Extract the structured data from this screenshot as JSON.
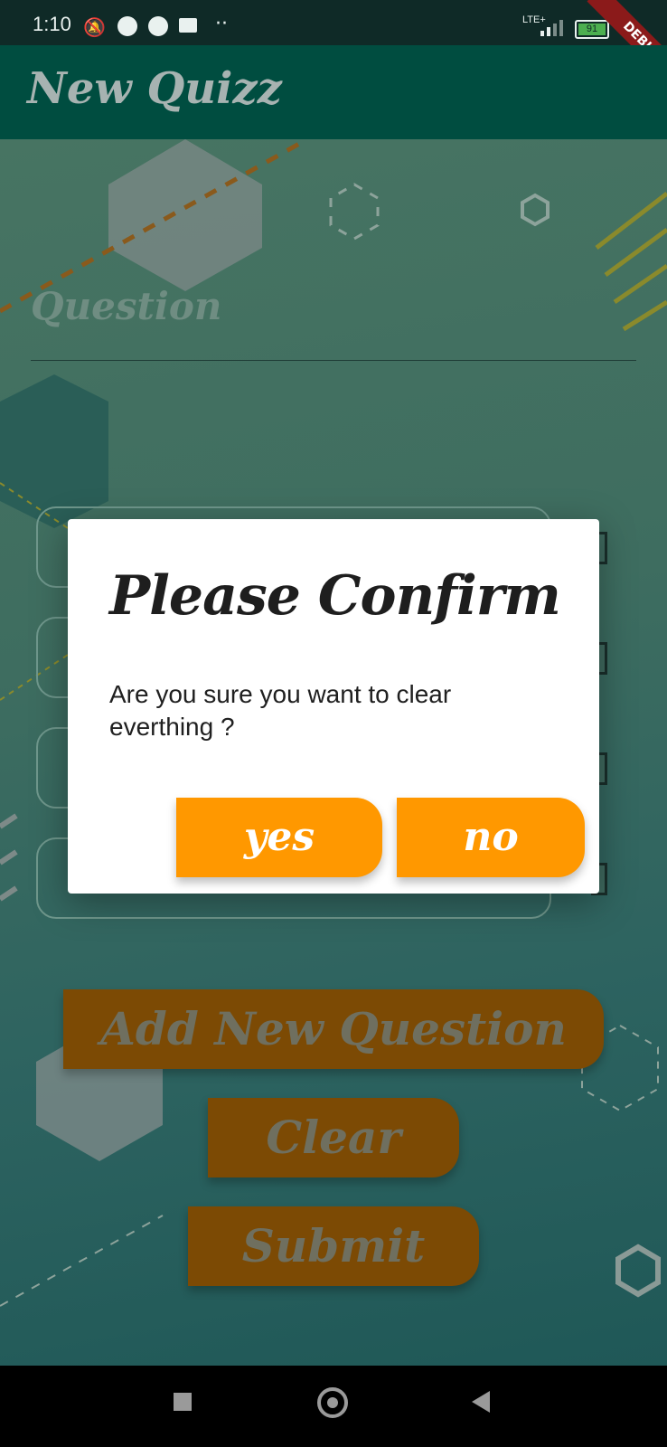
{
  "status_bar": {
    "time": "1:10",
    "network": "LTE+",
    "battery": "91",
    "icons": [
      "notifications-off-icon",
      "messenger-icon",
      "app-icon",
      "mail-icon",
      "more-dots-icon",
      "signal-icon",
      "battery-icon"
    ]
  },
  "debug_banner": "DEBUG",
  "app_bar": {
    "title": "New Quizz"
  },
  "form": {
    "question_label": "Question",
    "answer_fields": 4
  },
  "buttons": {
    "add_new_question": "Add New Question",
    "clear": "Clear",
    "submit": "Submit"
  },
  "dialog": {
    "title": "Please Confirm",
    "message": "Are you sure you want to clear everthing ?",
    "yes": "yes",
    "no": "no"
  },
  "nav_bar": {
    "icons": [
      "recents-icon",
      "home-icon",
      "back-icon"
    ]
  },
  "colors": {
    "app_bar": "#004d40",
    "accent_orange": "#ff9800",
    "dimmed_orange": "#7c4a04",
    "dialog_bg": "#ffffff"
  }
}
